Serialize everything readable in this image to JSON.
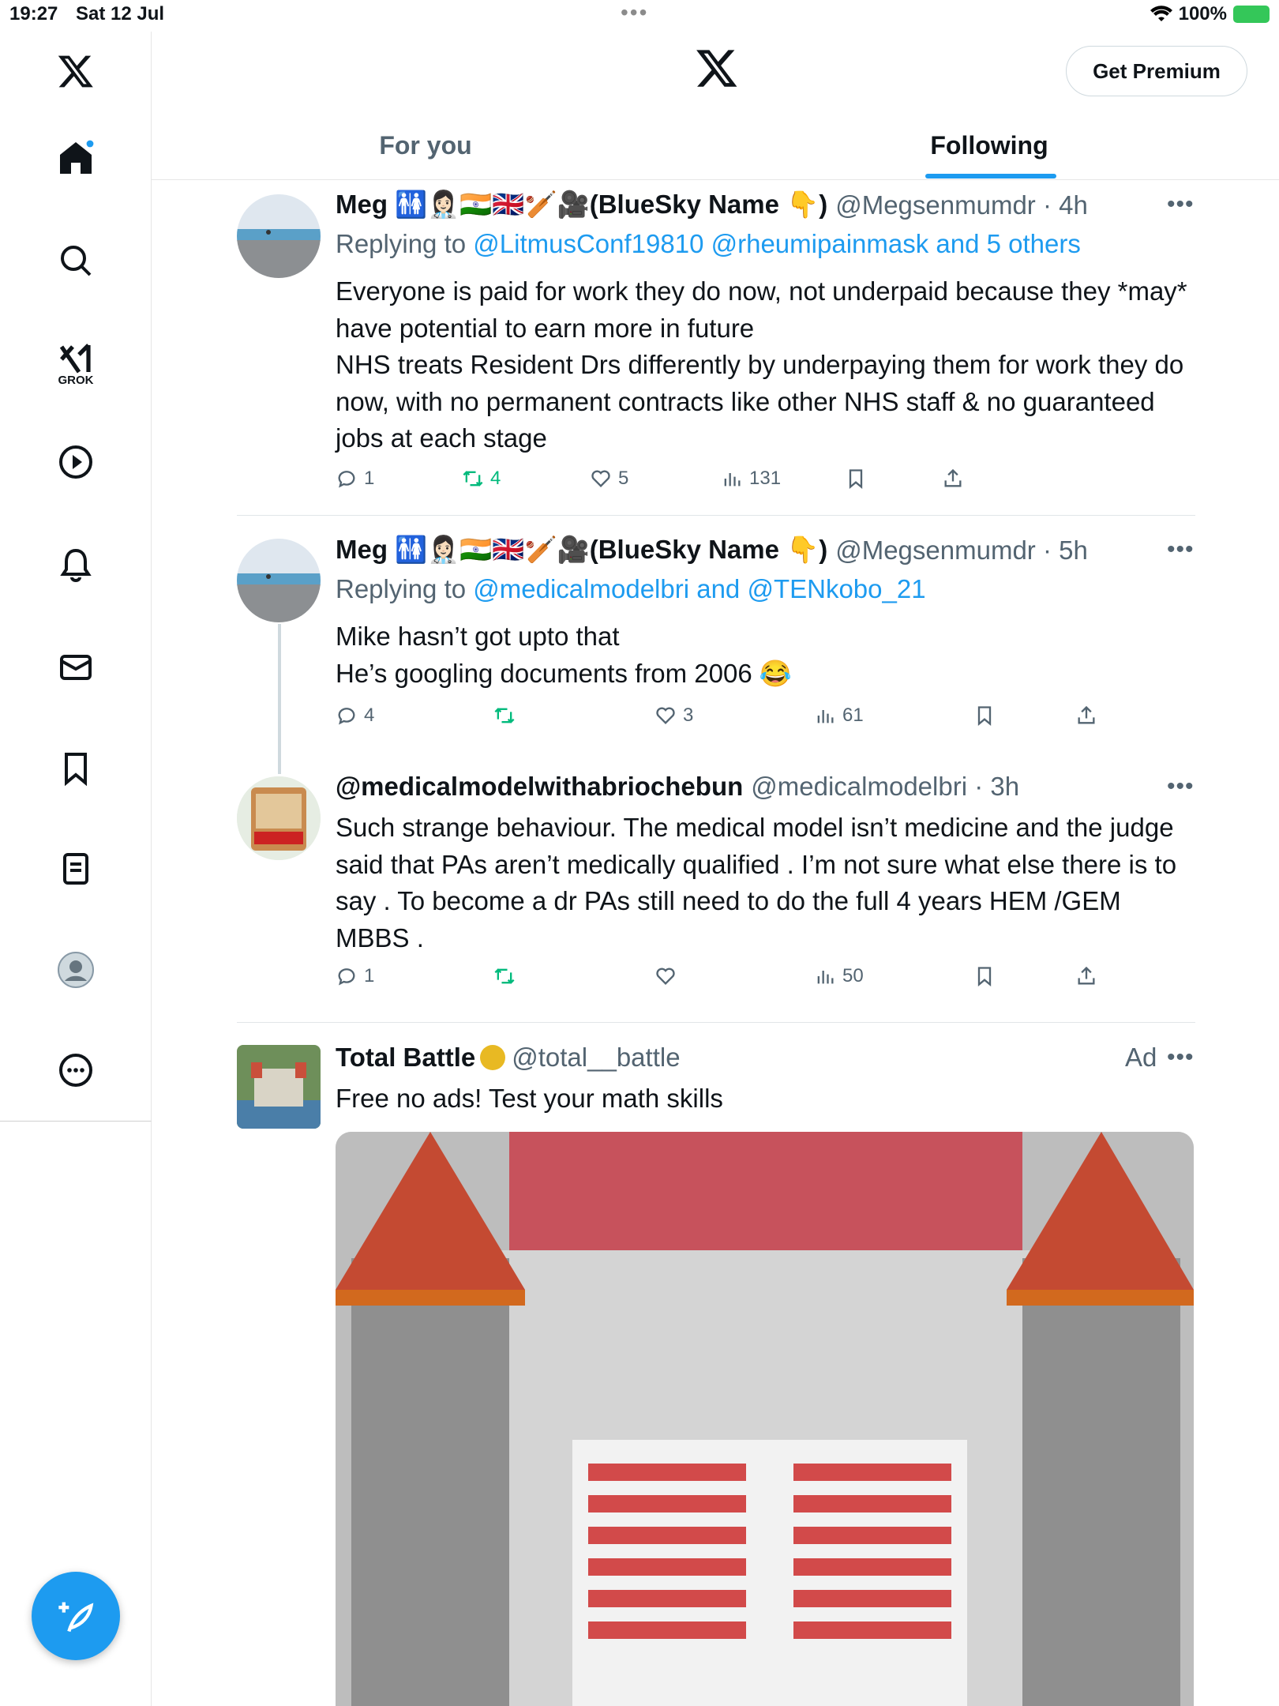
{
  "status": {
    "time": "19:27",
    "date": "Sat 12 Jul",
    "battery": "100%"
  },
  "sidebar": {
    "grok_label": "GROK"
  },
  "header": {
    "premium_label": "Get Premium"
  },
  "tabs": [
    {
      "label": "For you"
    },
    {
      "label": "Following"
    }
  ],
  "tweets": [
    {
      "name": "Meg 🚻👩🏻‍⚕️🇮🇳🇬🇧🏏🎥(BlueSky Name 👇)",
      "handle": "@Megsenmumdr · 4h",
      "reply_prefix": "Replying to",
      "reply_links": "@LitmusConf19810 @rheumipainmask and 5 others",
      "body": "Everyone is paid for work they do now, not underpaid because they *may* have potential to earn more in future\nNHS treats Resident Drs differently by underpaying them for work they do now, with no permanent contracts like other NHS staff & no guaranteed jobs at each stage",
      "replies": "1",
      "retweets": "4",
      "likes": "5",
      "views": "131"
    },
    {
      "name": "Meg 🚻👩🏻‍⚕️🇮🇳🇬🇧🏏🎥(BlueSky Name 👇)",
      "handle": "@Megsenmumdr · 5h",
      "reply_prefix": "Replying to",
      "reply_links": "@medicalmodelbri and @TENkobo_21",
      "body": "Mike hasn’t got upto that\nHe’s googling documents from 2006 😂",
      "replies": "4",
      "retweets": "",
      "likes": "3",
      "views": "61"
    },
    {
      "name": "@medicalmodelwithabriochebun",
      "handle": "@medicalmodelbri · 3h",
      "body": "Such strange behaviour. The medical model isn’t medicine and the judge said that PAs aren’t medically qualified . I’m not sure what else there is to say . To become a dr PAs still need to do the full 4 years HEM /GEM MBBS .",
      "replies": "1",
      "retweets": "",
      "likes": "",
      "views": "50"
    },
    {
      "name": "Total Battle",
      "handle": "@total__battle",
      "ad_label": "Ad",
      "body": "Free no ads! Test your math skills"
    }
  ]
}
